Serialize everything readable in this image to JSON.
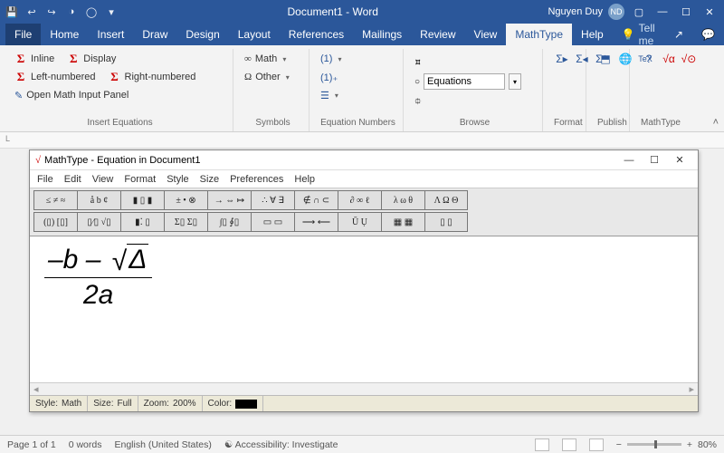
{
  "titlebar": {
    "doc_title": "Document1 - Word",
    "user_name": "Nguyen Duy",
    "user_initials": "ND"
  },
  "tabs": {
    "file": "File",
    "home": "Home",
    "insert": "Insert",
    "draw": "Draw",
    "design": "Design",
    "layout": "Layout",
    "references": "References",
    "mailings": "Mailings",
    "review": "Review",
    "view": "View",
    "mathtype": "MathType",
    "help": "Help",
    "tellme": "Tell me"
  },
  "ribbon": {
    "insert_eq": {
      "inline": "Inline",
      "display": "Display",
      "left_num": "Left-numbered",
      "right_num": "Right-numbered",
      "open_panel": "Open Math Input Panel",
      "label": "Insert Equations"
    },
    "symbols": {
      "math": "Math",
      "other": "Other",
      "label": "Symbols"
    },
    "eqnum": {
      "label": "Equation Numbers"
    },
    "browse": {
      "value": "Equations",
      "label": "Browse"
    },
    "format": {
      "label": "Format"
    },
    "publish": {
      "label": "Publish"
    },
    "mt": {
      "label": "MathType"
    }
  },
  "mathtype": {
    "title": "MathType - Equation in Document1",
    "menu": [
      "File",
      "Edit",
      "View",
      "Format",
      "Style",
      "Size",
      "Preferences",
      "Help"
    ],
    "palettes_row1": [
      "≤ ≠ ≈",
      "å b ¢",
      "▮ ▯ ▮",
      "± • ⊗",
      "→ ⇔ ↦",
      "∴ ∀ ∃",
      "∉ ∩ ⊂",
      "∂ ∞ ℓ",
      "λ ω θ",
      "Λ Ω Θ"
    ],
    "palettes_row2": [
      "(▯) [▯]",
      "▯⁄▯ √▯",
      "▮⁚ ▯",
      "Σ▯ Σ▯",
      "∫▯ ∮▯",
      "▭ ▭",
      "⟶ ⟵",
      "Ū Ụ",
      "▦ ▦",
      "▯ ▯"
    ],
    "status": {
      "style_label": "Style:",
      "style_value": "Math",
      "size_label": "Size:",
      "size_value": "Full",
      "zoom_label": "Zoom:",
      "zoom_value": "200%",
      "color_label": "Color:"
    },
    "equation": {
      "numerator_a": "–b –",
      "radicand": "Δ",
      "denominator": "2a"
    }
  },
  "word_status": {
    "page": "Page 1 of 1",
    "words": "0 words",
    "lang": "English (United States)",
    "a11y": "Accessibility: Investigate",
    "zoom": "80%"
  }
}
